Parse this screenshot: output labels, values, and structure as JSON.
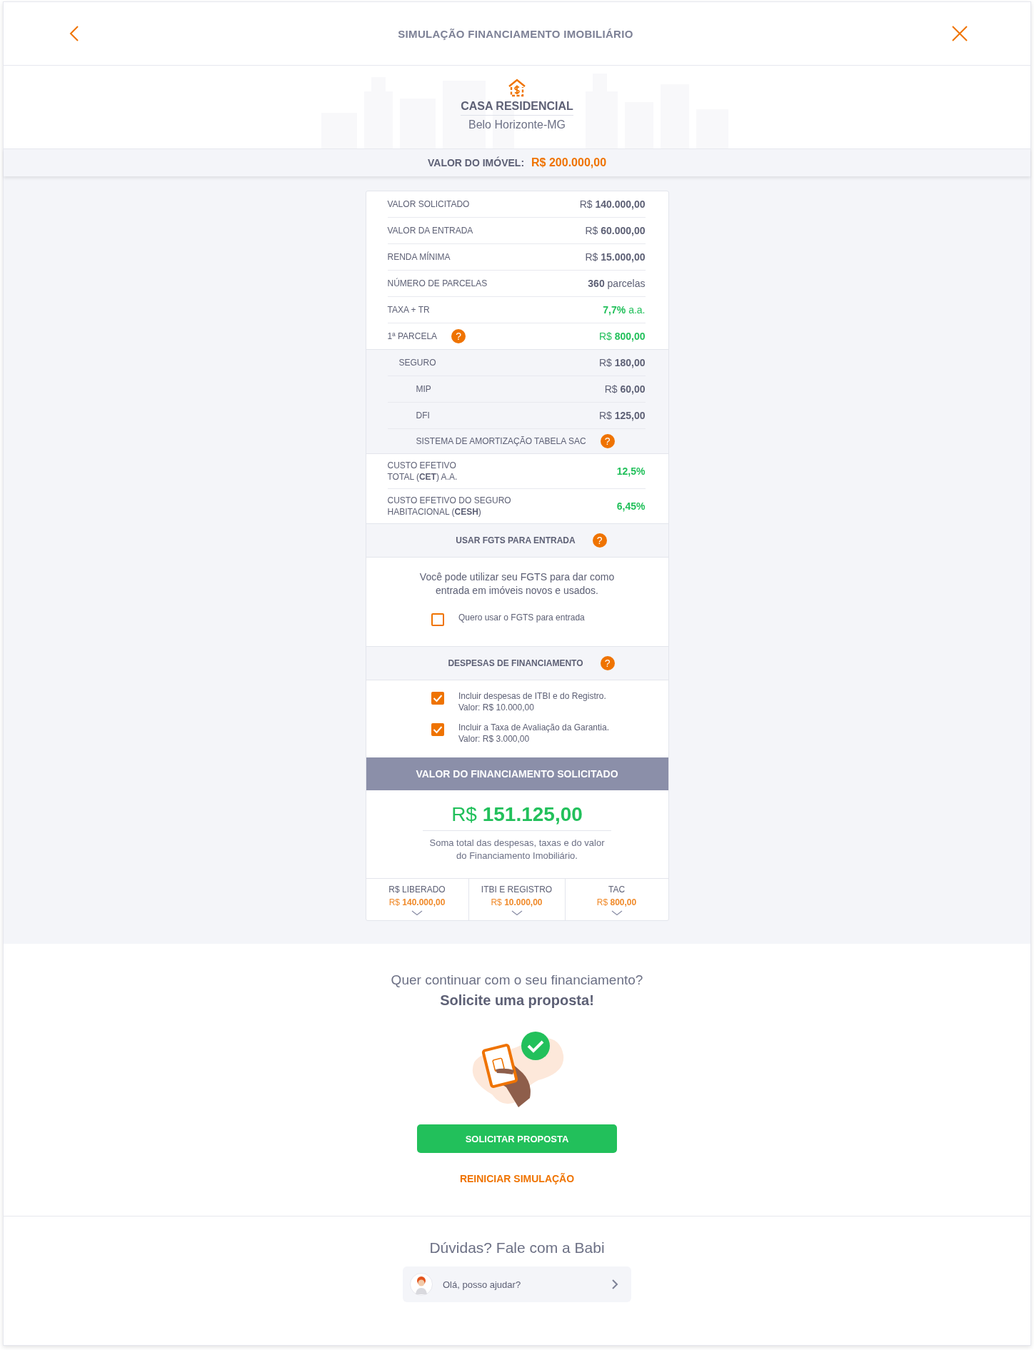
{
  "header": {
    "title": "SIMULAÇÃO FINANCIAMENTO IMOBILIÁRIO"
  },
  "property": {
    "type": "CASA RESIDENCIAL",
    "location": "Belo Horizonte-MG",
    "value_label": "VALOR DO IMÓVEL:",
    "value": "R$ 200.000,00"
  },
  "summary_rows": [
    {
      "label": "VALOR SOLICITADO",
      "value": "R$ **140.000,00**",
      "highlight": false
    },
    {
      "label": "VALOR DA ENTRADA",
      "value": "R$ **60.000,00**",
      "highlight": false
    },
    {
      "label": "RENDA MÍNIMA",
      "value": "R$ **15.000,00**",
      "highlight": false
    },
    {
      "label": "NÚMERO DE PARCELAS",
      "value": "**360** parcelas",
      "highlight": false
    },
    {
      "label": "TAXA + TR",
      "value": "**7,7%** a.a.",
      "highlight": true
    },
    {
      "label": "1ª PARCELA",
      "value": "R$ **800,00**",
      "highlight": true,
      "help": "?"
    }
  ],
  "insurance": {
    "label": "SEGURO",
    "value": "R$ **180,00**",
    "children": [
      {
        "label": "MIP",
        "value": "R$ **60,00**"
      },
      {
        "label": "DFI",
        "value": "R$ **125,00**"
      }
    ]
  },
  "amortization": {
    "label": "SISTEMA DE AMORTIZAÇÃO TABELA SAC",
    "help": "?"
  },
  "cost_rows": [
    {
      "label_lines": [
        "CUSTO EFETIVO",
        "TOTAL (**CET**) A.A."
      ],
      "value": "12,5%"
    },
    {
      "label_lines": [
        "CUSTO EFETIVO DO SEGURO",
        "HABITACIONAL (**CESH**)"
      ],
      "value": "6,45%"
    }
  ],
  "fgts": {
    "title": "USAR FGTS PARA ENTRADA",
    "help": "?",
    "description": "Você pode utilizar seu FGTS para dar como entrada em imóveis novos e usados.",
    "options": [
      {
        "label": "Quero usar o FGTS para entrada",
        "checked": false
      }
    ]
  },
  "expenses": {
    "title": "DESPESAS DE FINANCIAMENTO",
    "help": "?",
    "options": [
      {
        "label": "Incluir despesas de ITBI e do Registro.",
        "detail": "Valor: R$ 10.000,00",
        "checked": true
      },
      {
        "label": "Incluir a Taxa de Avaliação da Garantia.",
        "detail": "Valor: R$ 3.000,00",
        "checked": true
      }
    ]
  },
  "financing": {
    "title": "VALOR DO FINANCIAMENTO SOLICITADO",
    "total": "R$ **151.125,00**",
    "description": "Soma total das despesas, taxas e do valor do Financiamento Imobiliário.",
    "breakdown": [
      {
        "label": "R$ LIBERADO",
        "value": "R$ **140.000,00**"
      },
      {
        "label": "ITBI E REGISTRO",
        "value": "R$ **10.000,00**"
      },
      {
        "label": "TAC",
        "value": "R$ **800,00**"
      }
    ]
  },
  "cta": {
    "question": "Quer continuar com o seu financiamento?",
    "headline": "Solicite uma proposta!",
    "button": "SOLICITAR PROPOSTA",
    "link": "REINICIAR SIMULAÇÃO"
  },
  "help": {
    "title": "Dúvidas? Fale com a Babi",
    "chat": "Olá, posso ajudar?"
  }
}
